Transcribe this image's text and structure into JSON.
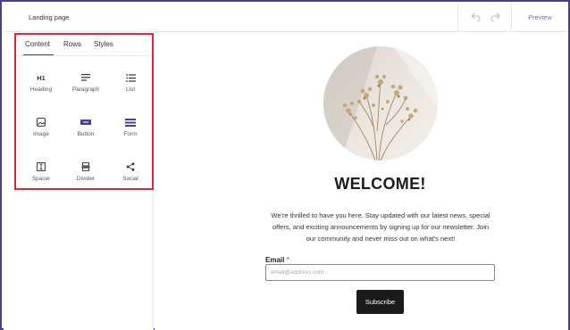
{
  "header": {
    "page_name": "Landing page",
    "preview_label": "Preview",
    "undo_icon": "undo-icon",
    "redo_icon": "redo-icon"
  },
  "sidebar": {
    "tabs": [
      {
        "label": "Content",
        "active": true
      },
      {
        "label": "Rows",
        "active": false
      },
      {
        "label": "Styles",
        "active": false
      }
    ],
    "h1_glyph": "H1",
    "blocks": [
      {
        "label": "Heading",
        "icon": "heading-icon"
      },
      {
        "label": "Paragraph",
        "icon": "paragraph-icon"
      },
      {
        "label": "List",
        "icon": "list-icon"
      },
      {
        "label": "Image",
        "icon": "image-icon"
      },
      {
        "label": "Button",
        "icon": "button-icon"
      },
      {
        "label": "Form",
        "icon": "form-icon"
      },
      {
        "label": "Spacer",
        "icon": "spacer-icon"
      },
      {
        "label": "Divider",
        "icon": "divider-icon"
      },
      {
        "label": "Social",
        "icon": "share-icon"
      }
    ]
  },
  "canvas": {
    "hero_image": "dried-flowers-photo",
    "heading": "WELCOME!",
    "intro_lines": [
      "We're thrilled to have you here. Stay updated with our latest news, special",
      "offers, and exciting announcements by signing up for our newsletter. Join",
      "our community and never miss out on what's next!"
    ],
    "email_label": "Email",
    "required_mark": "*",
    "email_placeholder": "email@address.com",
    "subscribe_label": "Subscribe"
  },
  "colors": {
    "frame_border": "#4b3c8f",
    "highlight_border": "#d8283c",
    "accent": "#6b6bd8",
    "button_bg": "#1a1a1a"
  }
}
